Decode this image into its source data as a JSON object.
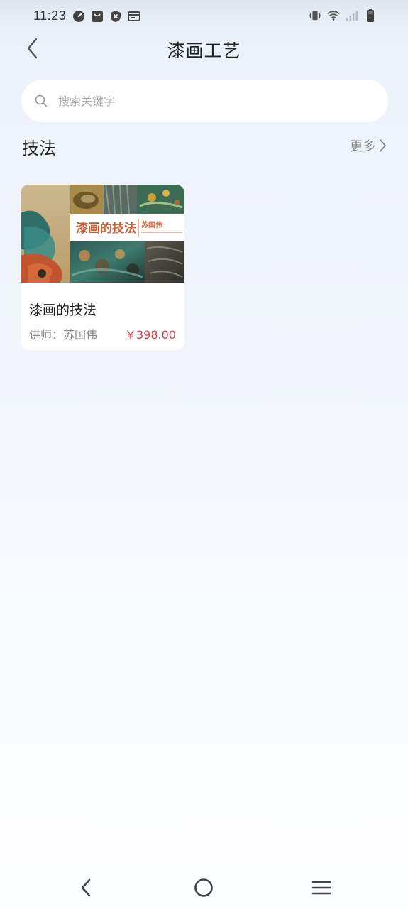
{
  "status_bar": {
    "time": "11:23",
    "left_icons": [
      "speedometer-icon",
      "shopping-bag-icon",
      "shield-x-icon",
      "card-icon"
    ],
    "right_icons": [
      "vibrate-icon",
      "wifi-icon",
      "signal-icon",
      "battery-icon"
    ]
  },
  "header": {
    "title": "漆画工艺",
    "back_icon": "chevron-left-icon"
  },
  "search": {
    "placeholder": "搜索关键字",
    "value": ""
  },
  "section": {
    "title": "技法",
    "more_label": "更多"
  },
  "courses": [
    {
      "title": "漆画的技法",
      "teacher": "讲师：苏国伟",
      "price": "￥398.00",
      "cover": {
        "banner_title": "漆画的技法",
        "banner_author": "苏国伟"
      }
    }
  ],
  "colors": {
    "accent_price": "#d9434a",
    "banner_title": "#c8623a",
    "card_bg": "#ffffff"
  },
  "nav_bar": {
    "icons": [
      "back-triangle-icon",
      "home-circle-icon",
      "menu-lines-icon"
    ]
  }
}
